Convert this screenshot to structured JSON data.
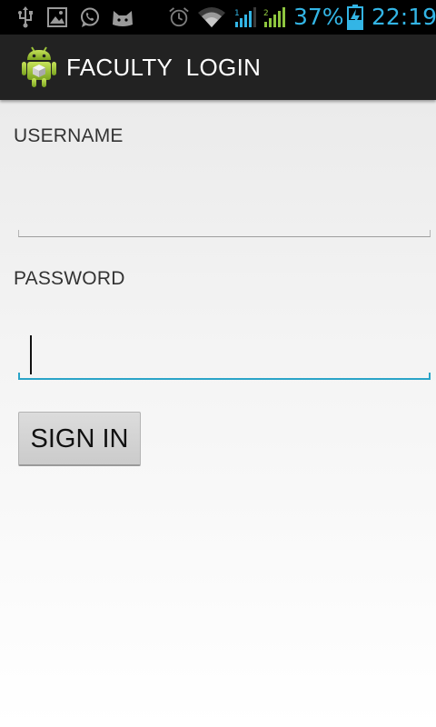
{
  "status_bar": {
    "battery_level": "37%",
    "time": "22:19",
    "accent_color": "#33b5e5",
    "icons": [
      "usb-icon",
      "image-icon",
      "whatsapp-icon",
      "cat-face-icon",
      "alarm-icon",
      "wifi-icon",
      "signal-sim1-icon",
      "signal-sim2-icon",
      "battery-charging-icon"
    ]
  },
  "action_bar": {
    "title": "FACULTY  LOGIN",
    "icon": "android-app-icon"
  },
  "form": {
    "username_label": "USERNAME",
    "username_value": "",
    "password_label": "PASSWORD",
    "password_value": "",
    "signin_label": "SIGN IN",
    "focused_field": "password",
    "focus_color": "#2aa4c8"
  }
}
